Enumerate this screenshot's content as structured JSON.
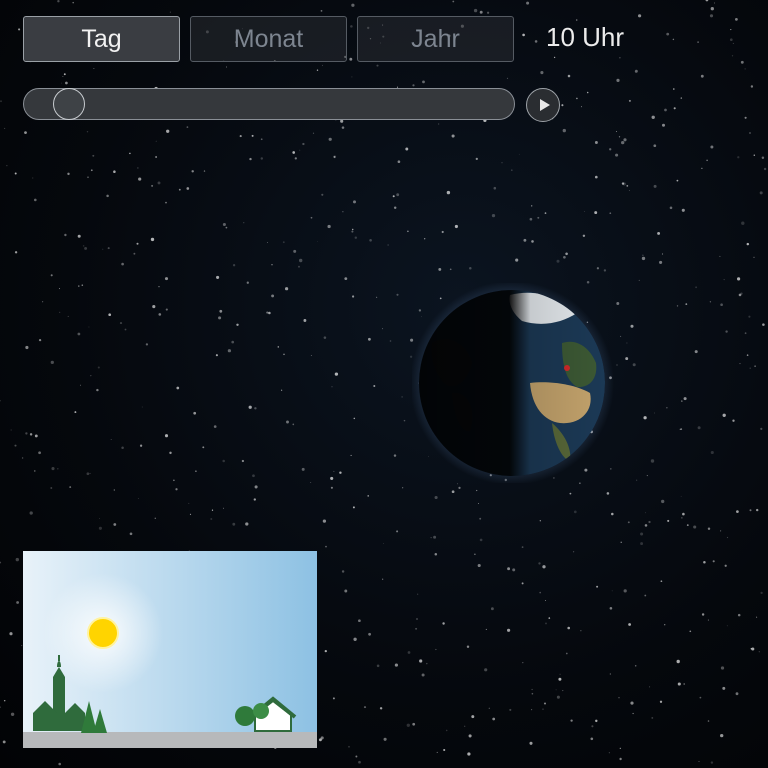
{
  "tabs": [
    {
      "label": "Tag",
      "active": true
    },
    {
      "label": "Monat",
      "active": false
    },
    {
      "label": "Jahr",
      "active": false
    }
  ],
  "time_label": "10 Uhr",
  "slider": {
    "value_hours": 1.5,
    "max_hours": 24
  },
  "play_button": {
    "icon": "play-icon"
  },
  "colors": {
    "accent_active": "#3a3d42",
    "text_active": "#f2f2f2",
    "text_inactive": "#7d8590",
    "sun": "#ffd400"
  },
  "scene": {
    "icons": [
      "sun-icon",
      "church-tower-icon",
      "tree-icon",
      "house-icon"
    ]
  }
}
